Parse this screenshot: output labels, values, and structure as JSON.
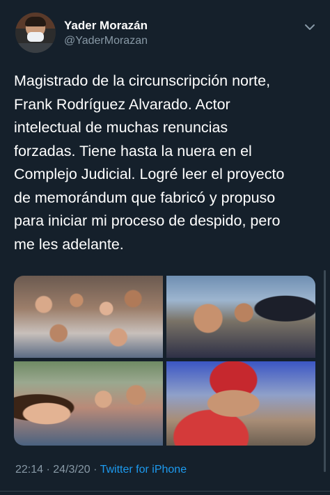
{
  "author": {
    "name": "Yader Morazán",
    "handle": "@YaderMorazan"
  },
  "tweet": {
    "text": "Magistrado de la circunscripción norte,\nFrank Rodríguez Alvarado. Actor\nintelectual de muchas renuncias\nforzadas. Tiene hasta la nuera en el\nComplejo Judicial. Logré leer el proyecto\nde memorándum que fabricó y propuso\npara iniciar mi proceso de despido, pero\nme les adelante."
  },
  "meta": {
    "time": "22:14",
    "separator": " · ",
    "date": "24/3/20",
    "source": "Twitter for iPhone"
  },
  "icons": {
    "more": "chevron-down-icon"
  }
}
